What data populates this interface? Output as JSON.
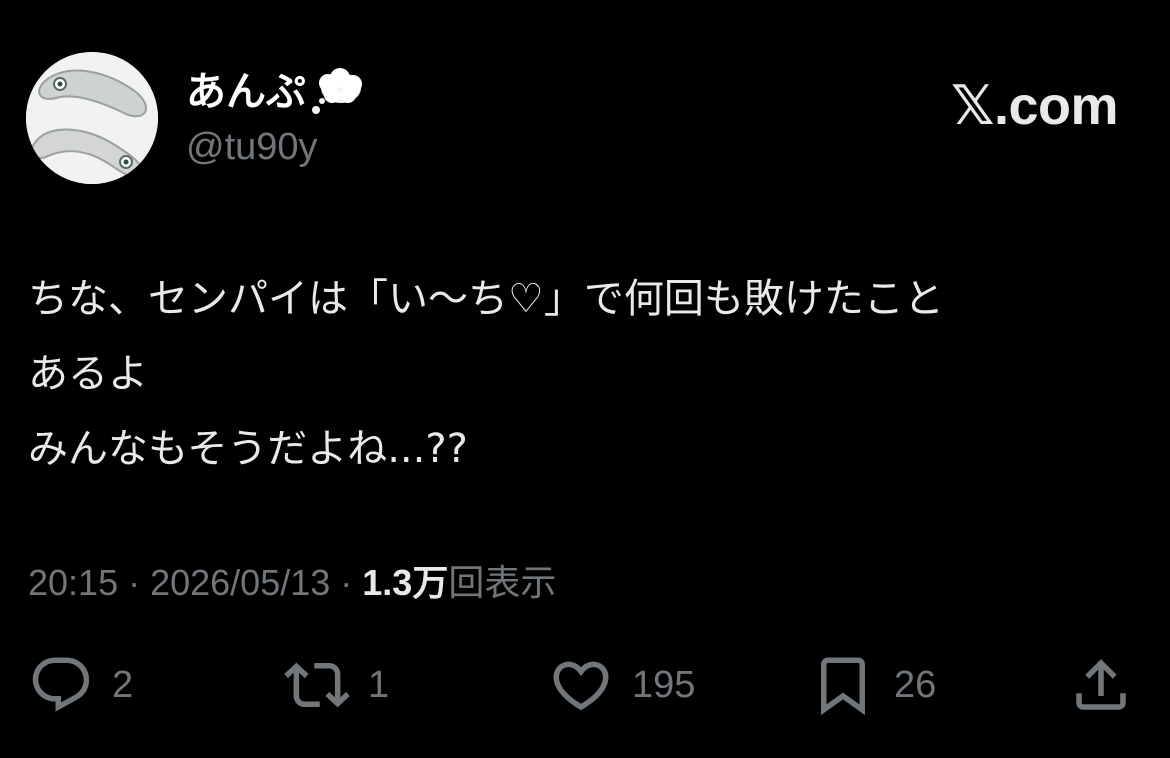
{
  "user": {
    "display_name": "あんぷ",
    "handle": "@tu90y",
    "status_icon": "thought-balloon"
  },
  "brand": {
    "x_glyph": "𝕏",
    "domain": ".com"
  },
  "tweet": {
    "lines": [
      "ちな、センパイは「い〜ち♡」で何回も敗けたこと",
      "あるよ",
      "みんなもそうだよね...??"
    ]
  },
  "meta": {
    "time": "20:15",
    "separator": "·",
    "date": "2026/05/13",
    "views_count": "1.3万",
    "views_label": "回表示"
  },
  "actions": {
    "reply": {
      "icon": "reply-icon",
      "count": "2"
    },
    "repost": {
      "icon": "repost-icon",
      "count": "1"
    },
    "like": {
      "icon": "heart-icon",
      "count": "195"
    },
    "bookmark": {
      "icon": "bookmark-icon",
      "count": "26"
    },
    "share": {
      "icon": "share-icon"
    }
  },
  "colors": {
    "background": "#000000",
    "text_primary": "#e7e9ea",
    "text_secondary": "#71767b"
  }
}
